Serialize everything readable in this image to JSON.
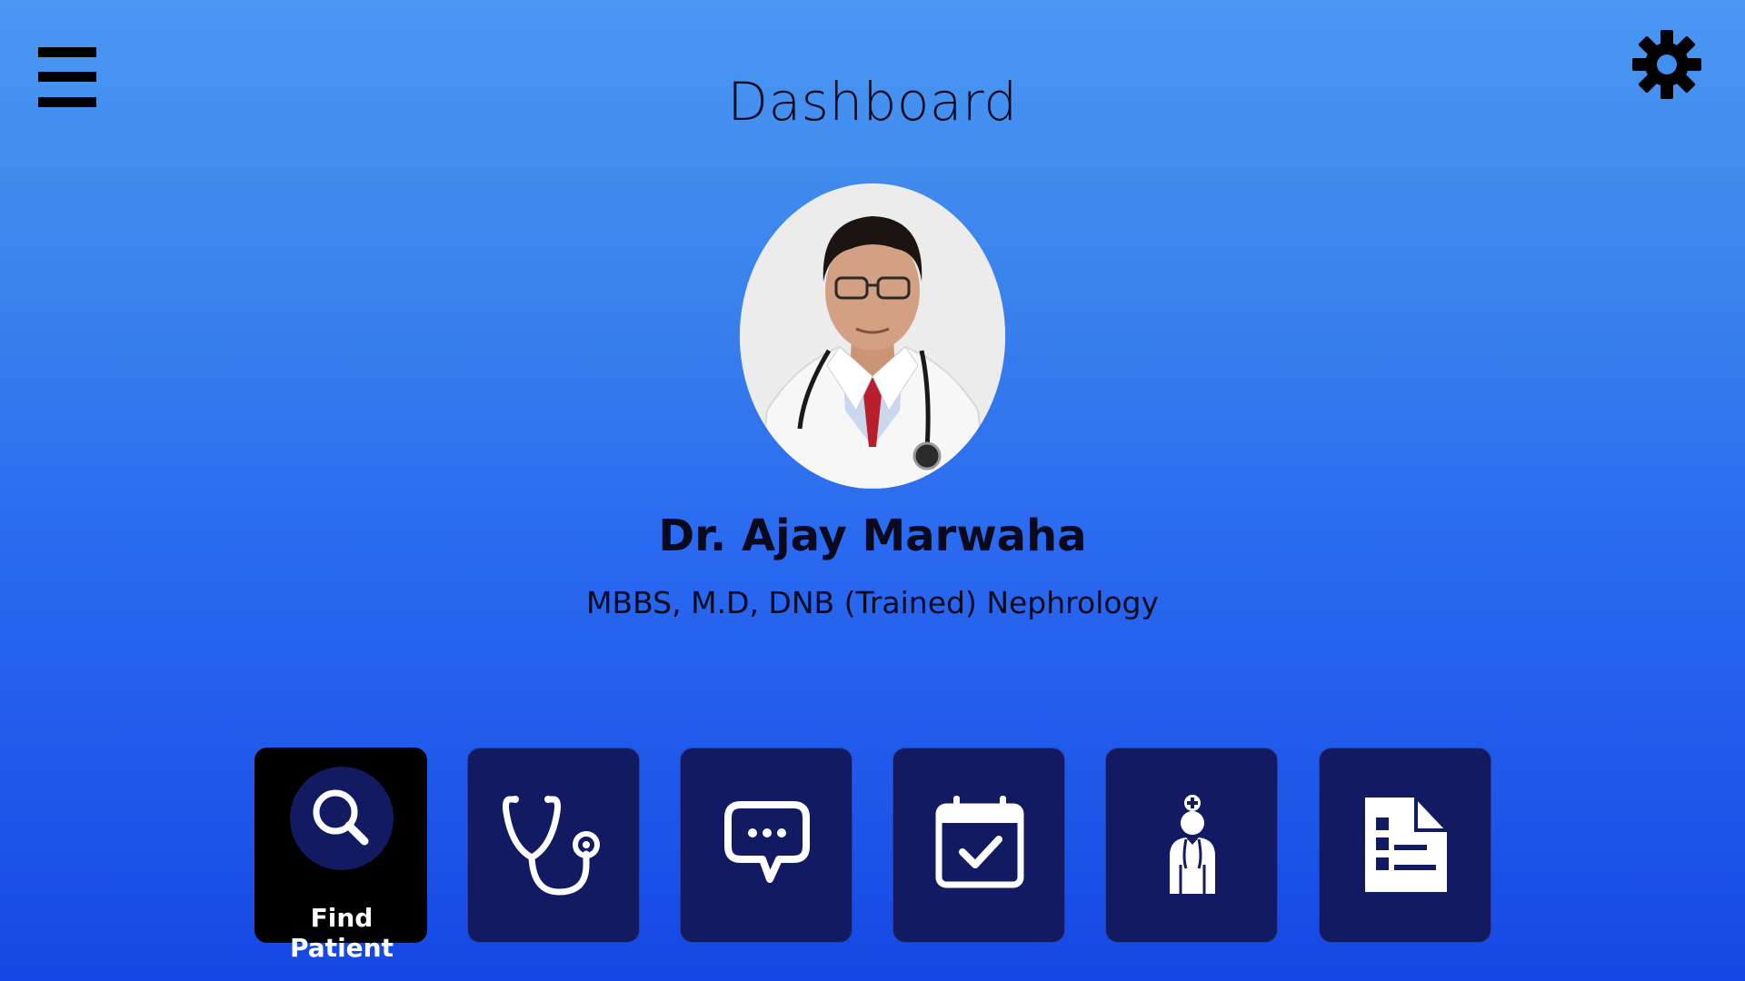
{
  "header": {
    "title": "Dashboard",
    "menu_icon": "hamburger-menu-icon",
    "settings_icon": "gear-icon"
  },
  "profile": {
    "name": "Dr. Ajay Marwaha",
    "qualifications": "MBBS, M.D, DNB (Trained) Nephrology"
  },
  "tiles": [
    {
      "label": "Find Patient",
      "icon": "search-icon",
      "active": true
    },
    {
      "label": "",
      "icon": "stethoscope-icon",
      "active": false
    },
    {
      "label": "",
      "icon": "chat-bubble-icon",
      "active": false
    },
    {
      "label": "",
      "icon": "calendar-check-icon",
      "active": false
    },
    {
      "label": "",
      "icon": "doctor-icon",
      "active": false
    },
    {
      "label": "",
      "icon": "report-document-icon",
      "active": false
    }
  ],
  "colors": {
    "background_top": "#4a98f2",
    "background_bottom": "#1448e4",
    "tile": "#121a62",
    "tile_active": "#000000",
    "text": "#0a0a1c"
  }
}
